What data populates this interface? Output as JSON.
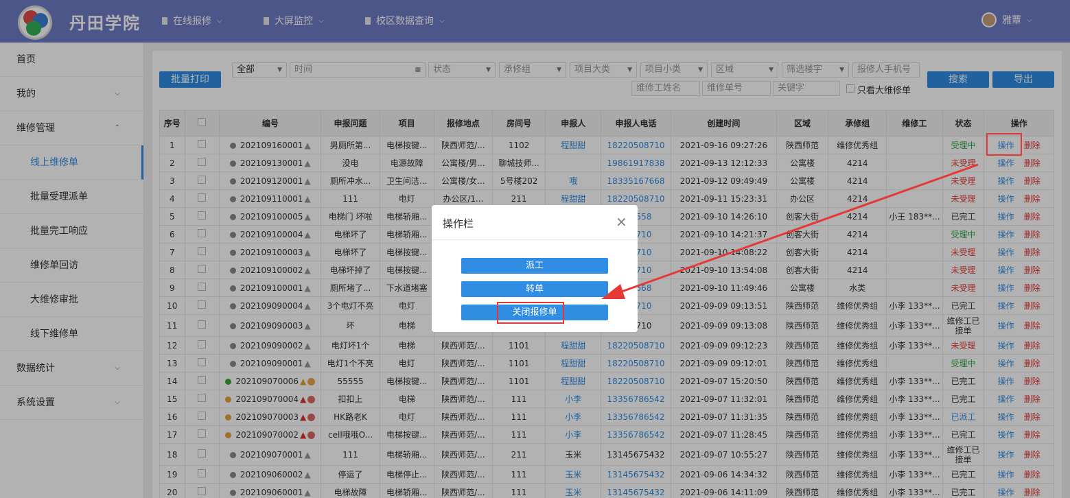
{
  "brand": "丹田学院",
  "nav": [
    "在线报修",
    "大屏监控",
    "校区数据查询"
  ],
  "user": "雅蕈",
  "sidebar": {
    "items": [
      {
        "label": "首页",
        "arrow": ""
      },
      {
        "label": "我的",
        "arrow": "⌵"
      },
      {
        "label": "维修管理",
        "arrow": "⌃"
      },
      {
        "label": "线上维修单",
        "arrow": ""
      },
      {
        "label": "批量受理派单",
        "arrow": ""
      },
      {
        "label": "批量完工响应",
        "arrow": ""
      },
      {
        "label": "维修单回访",
        "arrow": ""
      },
      {
        "label": "大维修审批",
        "arrow": ""
      },
      {
        "label": "线下维修单",
        "arrow": ""
      },
      {
        "label": "数据统计",
        "arrow": "⌵"
      },
      {
        "label": "系统设置",
        "arrow": "⌵"
      }
    ]
  },
  "toolbar": {
    "batch_print": "批量打印",
    "search": "搜索",
    "export": "导出",
    "only_big": "只看大维修单"
  },
  "filters": {
    "all": "全部",
    "time": "时间",
    "status": "状态",
    "group": "承修组",
    "cat_big": "项目大类",
    "cat_small": "项目小类",
    "area": "区域",
    "building": "筛选楼宇",
    "phone": "报修人手机号",
    "worker": "维修工姓名",
    "order_no": "维修单号",
    "keyword": "关键字"
  },
  "table": {
    "headers": [
      "序号",
      "",
      "编号",
      "申报问题",
      "项目",
      "报修地点",
      "房间号",
      "申报人",
      "申报人电话",
      "创建时间",
      "区域",
      "承修组",
      "维修工",
      "状态",
      "操作"
    ],
    "op_label": "操作",
    "del_label": "删除",
    "rows": [
      {
        "no": "1",
        "dot": "#888",
        "id": "202109160001",
        "marks": "w",
        "problem": "男厕所第...",
        "project": "电梯按键...",
        "place": "陕西师范/...",
        "room": "1102",
        "person": "程甜甜",
        "phone": "18220508710",
        "time": "2021-09-16 09:27:26",
        "area": "陕西师范",
        "group": "维修优秀组",
        "worker": "",
        "status": "受理中",
        "sc": "grn",
        "tall": false
      },
      {
        "no": "2",
        "dot": "#888",
        "id": "202109130001",
        "marks": "w",
        "problem": "没电",
        "project": "电源故障",
        "place": "公寓楼/男...",
        "room": "聊城技师...",
        "person": "",
        "phone": "19861917838",
        "time": "2021-09-13 12:12:33",
        "area": "公寓楼",
        "group": "4214",
        "worker": "",
        "status": "未受理",
        "sc": "red",
        "tall": false
      },
      {
        "no": "3",
        "dot": "#888",
        "id": "202109120001",
        "marks": "w",
        "problem": "厕所冲水...",
        "project": "卫生间洁...",
        "place": "公寓楼/女...",
        "room": "5号楼202",
        "person": "哦",
        "phone": "18335167668",
        "time": "2021-09-12 09:49:49",
        "area": "公寓楼",
        "group": "4214",
        "worker": "",
        "status": "未受理",
        "sc": "red",
        "tall": false
      },
      {
        "no": "4",
        "dot": "#888",
        "id": "202109110001",
        "marks": "w",
        "problem": "111",
        "project": "电灯",
        "place": "办公区/1...",
        "room": "211",
        "person": "程甜甜",
        "phone": "18220508710",
        "time": "2021-09-11 15:23:31",
        "area": "办公区",
        "group": "4214",
        "worker": "",
        "status": "未受理",
        "sc": "red",
        "tall": false
      },
      {
        "no": "5",
        "dot": "#888",
        "id": "202109100005",
        "marks": "w",
        "problem": "电梯门 坏啦",
        "project": "电梯轿厢...",
        "place": "",
        "room": "",
        "person": "",
        "phone": "909558",
        "time": "2021-09-10 14:26:10",
        "area": "创客大街",
        "group": "4214",
        "worker": "小王 183**...",
        "status": "已完工",
        "sc": "",
        "tall": false
      },
      {
        "no": "6",
        "dot": "#888",
        "id": "202109100004",
        "marks": "w",
        "problem": "电梯坏了",
        "project": "电梯轿厢...",
        "place": "",
        "room": "",
        "person": "",
        "phone": "508710",
        "time": "2021-09-10 14:21:37",
        "area": "创客大街",
        "group": "4214",
        "worker": "",
        "status": "受理中",
        "sc": "grn",
        "tall": false
      },
      {
        "no": "7",
        "dot": "#888",
        "id": "202109100003",
        "marks": "w",
        "problem": "电梯坏了",
        "project": "电梯按键...",
        "place": "",
        "room": "",
        "person": "",
        "phone": "508710",
        "time": "2021-09-10 14:08:22",
        "area": "创客大街",
        "group": "4214",
        "worker": "",
        "status": "未受理",
        "sc": "red",
        "tall": false
      },
      {
        "no": "8",
        "dot": "#888",
        "id": "202109100002",
        "marks": "w",
        "problem": "电梯坏掉了",
        "project": "电梯按键...",
        "place": "",
        "room": "",
        "person": "",
        "phone": "508710",
        "time": "2021-09-10 13:54:08",
        "area": "创客大街",
        "group": "4214",
        "worker": "",
        "status": "未受理",
        "sc": "red",
        "tall": false
      },
      {
        "no": "9",
        "dot": "#888",
        "id": "202109100001",
        "marks": "w",
        "problem": "厕所堵了...",
        "project": "下水道堵塞",
        "place": "",
        "room": "",
        "person": "",
        "phone": "167668",
        "time": "2021-09-10 11:49:46",
        "area": "公寓楼",
        "group": "水类",
        "worker": "",
        "status": "未受理",
        "sc": "red",
        "tall": false
      },
      {
        "no": "10",
        "dot": "#888",
        "id": "202109090004",
        "marks": "w",
        "problem": "3个电灯不亮",
        "project": "电灯",
        "place": "",
        "room": "",
        "person": "",
        "phone": "508710",
        "time": "2021-09-09 09:13:51",
        "area": "陕西师范",
        "group": "维修优秀组",
        "worker": "小李 133**...",
        "status": "已完工",
        "sc": "",
        "tall": false
      },
      {
        "no": "11",
        "dot": "#888",
        "id": "202109090003",
        "marks": "w",
        "problem": "坏",
        "project": "电梯",
        "place": "",
        "room": "",
        "person": "",
        "phone": "508710",
        "time": "2021-09-09 09:13:08",
        "area": "陕西师范",
        "group": "维修优秀组",
        "worker": "小李 133**...",
        "status": "维修工已接单",
        "sc": "orn",
        "tall": true
      },
      {
        "no": "12",
        "dot": "#888",
        "id": "202109090002",
        "marks": "w",
        "problem": "电灯坏1个",
        "project": "电梯",
        "place": "陕西师范/...",
        "room": "1101",
        "person": "程甜甜",
        "phone": "18220508710",
        "time": "2021-09-09 09:12:23",
        "area": "陕西师范",
        "group": "维修优秀组",
        "worker": "小李 133**...",
        "status": "未受理",
        "sc": "red",
        "tall": false
      },
      {
        "no": "13",
        "dot": "#888",
        "id": "202109090001",
        "marks": "w",
        "problem": "电灯1个不亮",
        "project": "电灯",
        "place": "陕西师范/...",
        "room": "1101",
        "person": "程甜甜",
        "phone": "18220508710",
        "time": "2021-09-09 09:12:01",
        "area": "陕西师范",
        "group": "维修优秀组",
        "worker": "",
        "status": "受理中",
        "sc": "grn",
        "tall": false
      },
      {
        "no": "14",
        "dot": "#3aa83a",
        "id": "202109070006",
        "marks": "wo",
        "problem": "55555",
        "project": "电梯按键...",
        "place": "陕西师范/...",
        "room": "1101",
        "person": "程甜甜",
        "phone": "18220508710",
        "time": "2021-09-07 15:20:50",
        "area": "陕西师范",
        "group": "维修优秀组",
        "worker": "小李 133**...",
        "status": "已完工",
        "sc": "",
        "tall": false
      },
      {
        "no": "15",
        "dot": "#e8a23a",
        "id": "202109070004",
        "marks": "rr",
        "problem": "扣扣上",
        "project": "电梯",
        "place": "陕西师范/...",
        "room": "111",
        "person": "小李",
        "phone": "13356786542",
        "time": "2021-09-07 11:32:01",
        "area": "陕西师范",
        "group": "维修优秀组",
        "worker": "小李 133**...",
        "status": "已完工",
        "sc": "",
        "tall": false
      },
      {
        "no": "16",
        "dot": "#e8a23a",
        "id": "202109070003",
        "marks": "rr",
        "problem": "HK路老K",
        "project": "电灯",
        "place": "陕西师范/...",
        "room": "111",
        "person": "小李",
        "phone": "13356786542",
        "time": "2021-09-07 11:31:35",
        "area": "陕西师范",
        "group": "维修优秀组",
        "worker": "小李 133**...",
        "status": "已派工",
        "sc": "blu",
        "tall": false
      },
      {
        "no": "17",
        "dot": "#e8a23a",
        "id": "202109070002",
        "marks": "rr",
        "problem": "cell哦哦O...",
        "project": "电梯按键...",
        "place": "陕西师范/...",
        "room": "111",
        "person": "小李",
        "phone": "13356786542",
        "time": "2021-09-07 11:28:45",
        "area": "陕西师范",
        "group": "维修优秀组",
        "worker": "小李 133**...",
        "status": "已完工",
        "sc": "",
        "tall": false
      },
      {
        "no": "18",
        "dot": "#888",
        "id": "202109070001",
        "marks": "w",
        "problem": "111",
        "project": "电梯轿厢...",
        "place": "陕西师范/...",
        "room": "211",
        "person": "玉米",
        "phone": "13145675432",
        "time": "2021-09-07 10:55:27",
        "area": "陕西师范",
        "group": "维修优秀组",
        "worker": "小李 133**...",
        "status": "维修工已接单",
        "sc": "orn",
        "tall": true
      },
      {
        "no": "19",
        "dot": "#888",
        "id": "202109060002",
        "marks": "w",
        "problem": "停运了",
        "project": "电梯停止...",
        "place": "陕西师范/...",
        "room": "111",
        "person": "玉米",
        "phone": "13145675432",
        "time": "2021-09-06 14:34:32",
        "area": "陕西师范",
        "group": "维修优秀组",
        "worker": "小李 133**...",
        "status": "已完工",
        "sc": "",
        "tall": false
      },
      {
        "no": "20",
        "dot": "#888",
        "id": "202109060001",
        "marks": "w",
        "problem": "电梯故障",
        "project": "电梯轿厢...",
        "place": "陕西师范/...",
        "room": "111",
        "person": "玉米",
        "phone": "13145675432",
        "time": "2021-09-06 14:11:09",
        "area": "陕西师范",
        "group": "维修优秀组",
        "worker": "小李 133**...",
        "status": "已完工",
        "sc": "",
        "tall": false
      }
    ]
  },
  "modal": {
    "title": "操作栏",
    "close": "×",
    "buttons": [
      "派工",
      "转单",
      "关闭报修单"
    ]
  },
  "colors": {
    "primary": "#2f8de4",
    "topbar": "#6f7bc4",
    "highlight": "#e53935"
  }
}
